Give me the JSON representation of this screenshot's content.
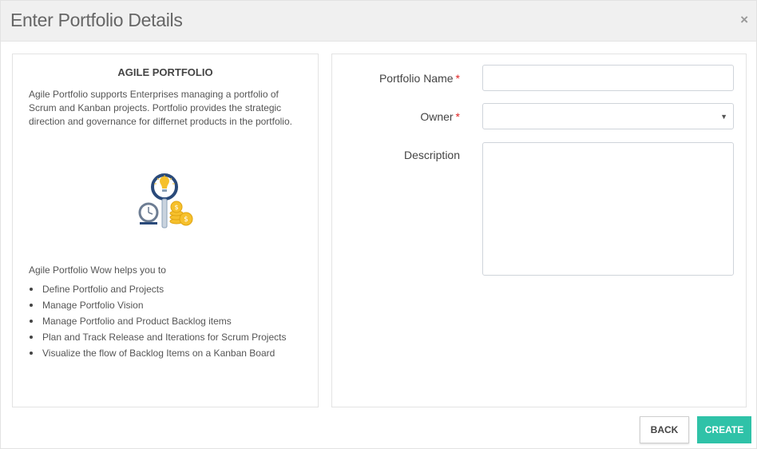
{
  "dialog": {
    "title": "Enter Portfolio Details",
    "close_icon": "×"
  },
  "info_panel": {
    "heading": "AGILE PORTFOLIO",
    "description": "Agile Portfolio supports Enterprises managing a portfolio of Scrum and Kanban projects. Portfolio provides the strategic direction and governance for differnet products in the portfolio.",
    "illustration": "portfolio-illustration-icon",
    "intro": "Agile Portfolio Wow helps you to",
    "features": [
      "Define Portfolio and Projects",
      "Manage Portfolio Vision",
      "Manage Portfolio and Product Backlog items",
      "Plan and Track Release and Iterations for Scrum Projects",
      "Visualize the flow of Backlog Items on a Kanban Board"
    ]
  },
  "form": {
    "portfolio_name": {
      "label": "Portfolio Name",
      "required_mark": "*",
      "value": ""
    },
    "owner": {
      "label": "Owner",
      "required_mark": "*",
      "selected": "",
      "arrow": "▼"
    },
    "description": {
      "label": "Description",
      "value": ""
    }
  },
  "footer": {
    "back_label": "BACK",
    "create_label": "CREATE"
  },
  "colors": {
    "accent": "#2fc2a8",
    "required": "#e02424"
  }
}
